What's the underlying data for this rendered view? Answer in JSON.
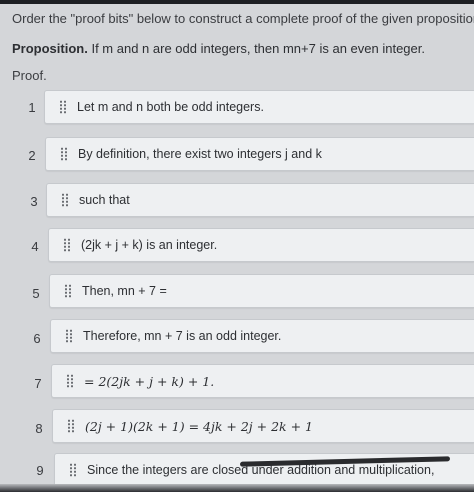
{
  "instruction": "Order the \"proof bits\" below to construct a complete proof of the given proposition.",
  "proposition": {
    "label": "Proposition.",
    "text": "If m and n are odd integers, then mn+7 is an even integer."
  },
  "proof_label": "Proof.",
  "rows": [
    {
      "num": "1",
      "text": "Let m and n both be odd integers."
    },
    {
      "num": "2",
      "text": "By definition, there exist two integers j and k"
    },
    {
      "num": "3",
      "text": "such that"
    },
    {
      "num": "4",
      "text": "(2jk + j + k) is an integer."
    },
    {
      "num": "5",
      "text": "Then, mn + 7 ="
    },
    {
      "num": "6",
      "text": "Therefore, mn + 7 is an odd integer."
    },
    {
      "num": "7",
      "text": "= 2(2jk + j + k) + 1."
    },
    {
      "num": "8",
      "text": "(2j + 1)(2k + 1) = 4jk + 2j + 2k + 1"
    },
    {
      "num": "9",
      "text": "Since the integers are closed under addition and multiplication,"
    }
  ],
  "icons": {
    "drag_handle": "drag-handle-icon"
  }
}
